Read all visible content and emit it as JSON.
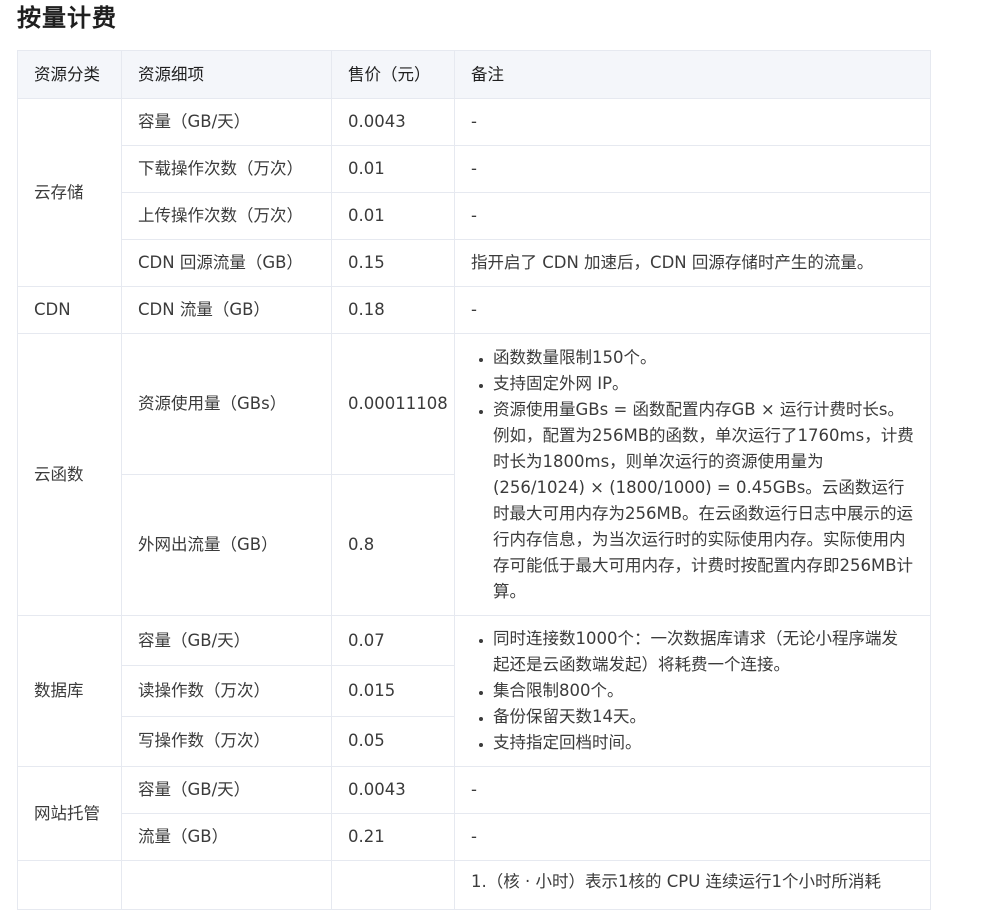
{
  "title": "按量计费",
  "table": {
    "headers": [
      "资源分类",
      "资源细项",
      "售价（元）",
      "备注"
    ],
    "cloud_storage": {
      "category": "云存储",
      "rows": [
        {
          "item": "容量（GB/天）",
          "price": "0.0043",
          "note": "-"
        },
        {
          "item": "下载操作次数（万次）",
          "price": "0.01",
          "note": "-"
        },
        {
          "item": "上传操作次数（万次）",
          "price": "0.01",
          "note": "-"
        },
        {
          "item": "CDN 回源流量（GB）",
          "price": "0.15",
          "note": "指开启了 CDN 加速后，CDN 回源存储时产生的流量。"
        }
      ]
    },
    "cdn": {
      "category": "CDN",
      "item": "CDN 流量（GB）",
      "price": "0.18",
      "note": "-"
    },
    "cloud_function": {
      "category": "云函数",
      "rows": [
        {
          "item": "资源使用量（GBs）",
          "price": "0.00011108"
        },
        {
          "item": "外网出流量（GB）",
          "price": "0.8"
        }
      ],
      "notes": [
        "函数数量限制150个。",
        "支持固定外网 IP。",
        "资源使用量GBs = 函数配置内存GB × 运行计费时长s。例如，配置为256MB的函数，单次运行了1760ms，计费时长为1800ms，则单次运行的资源使用量为 (256/1024) × (1800/1000) = 0.45GBs。云函数运行时最大可用内存为256MB。在云函数运行日志中展示的运行内存信息，为当次运行时的实际使用内存。实际使用内存可能低于最大可用内存，计费时按配置内存即256MB计算。"
      ]
    },
    "database": {
      "category": "数据库",
      "rows": [
        {
          "item": "容量（GB/天）",
          "price": "0.07"
        },
        {
          "item": "读操作数（万次）",
          "price": "0.015"
        },
        {
          "item": "写操作数（万次）",
          "price": "0.05"
        }
      ],
      "notes": [
        "同时连接数1000个：一次数据库请求（无论小程序端发起还是云函数端发起）将耗费一个连接。",
        "集合限制800个。",
        "备份保留天数14天。",
        "支持指定回档时间。"
      ]
    },
    "web_hosting": {
      "category": "网站托管",
      "rows": [
        {
          "item": "容量（GB/天）",
          "price": "0.0043",
          "note": "-"
        },
        {
          "item": "流量（GB）",
          "price": "0.21",
          "note": "-"
        }
      ]
    },
    "partial_row_note": "1.（核 · 小时）表示1核的 CPU 连续运行1个小时所消耗"
  }
}
